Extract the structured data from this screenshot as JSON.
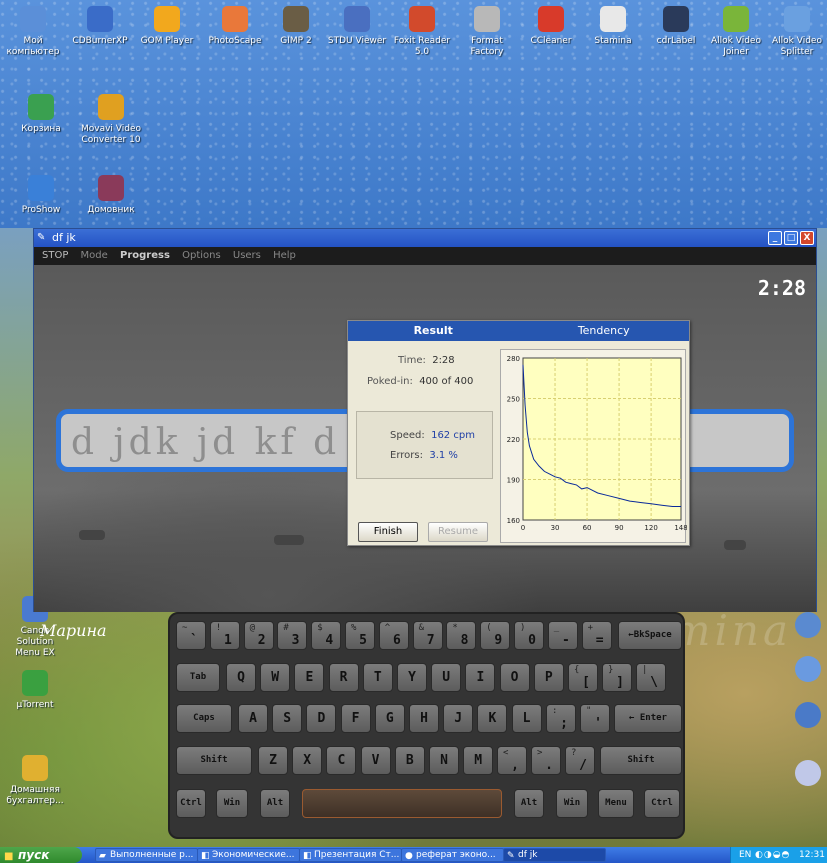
{
  "desktop_icons_top": [
    {
      "label": "Мой компьютер",
      "icon": "my-computer-icon",
      "color": "#5b8fd8"
    },
    {
      "label": "CDBurnerXP",
      "icon": "cdburnerxp-icon",
      "color": "#3a6cc8"
    },
    {
      "label": "GOM Player",
      "icon": "gom-player-icon",
      "color": "#f2a81d"
    },
    {
      "label": "PhotoScape",
      "icon": "photoscape-icon",
      "color": "#e9783a"
    },
    {
      "label": "GIMP 2",
      "icon": "gimp-icon",
      "color": "#6a5d45"
    },
    {
      "label": "STDU Viewer",
      "icon": "stdu-viewer-icon",
      "color": "#4a6fc0"
    },
    {
      "label": "Foxit Reader 5.0",
      "icon": "foxit-reader-icon",
      "color": "#d24a2c"
    },
    {
      "label": "Format Factory",
      "icon": "format-factory-icon",
      "color": "#b8b8b8"
    },
    {
      "label": "CCleaner",
      "icon": "ccleaner-icon",
      "color": "#d83a2a"
    },
    {
      "label": "Stamina",
      "icon": "stamina-icon",
      "color": "#e8e8e8"
    },
    {
      "label": "cdrLabel",
      "icon": "cdrlabel-icon",
      "color": "#2a3a5a"
    },
    {
      "label": "Allok Video Joiner",
      "icon": "allok-video-joiner-icon",
      "color": "#7ab53a"
    },
    {
      "label": "Allok Video Splitter",
      "icon": "allok-video-splitter-icon",
      "color": "#6aa0e0"
    }
  ],
  "desktop_icons_second": [
    {
      "label": "Корзина",
      "icon": "recycle-bin-icon",
      "color": "#3aa050"
    },
    {
      "label": "Movavi Video Converter 10",
      "icon": "movavi-icon",
      "color": "#e0a020"
    }
  ],
  "desktop_icons_third": [
    {
      "label": "ProShow",
      "icon": "proshow-icon",
      "color": "#3a80d8"
    },
    {
      "label": "Домовник",
      "icon": "domovnik-icon",
      "color": "#8a3a5a"
    }
  ],
  "desktop_icons_left_lower": [
    {
      "label": "Canon Solution Menu EX",
      "icon": "canon-solution-icon",
      "color": "#4a7ad0"
    },
    {
      "label": "µTorrent",
      "icon": "utorrent-icon",
      "color": "#3aa040"
    },
    {
      "label": "Домашняя бухгалтер...",
      "icon": "home-accounting-icon",
      "color": "#e0b030"
    }
  ],
  "window": {
    "title": "df jk",
    "menu": [
      "STOP",
      "Mode",
      "Progress",
      "Options",
      "Users",
      "Help"
    ],
    "timer": "2:28",
    "typed_text": "d jdk jd kf d",
    "username": "Марина",
    "watermark": "stamina"
  },
  "dialog": {
    "tabs": [
      "Result",
      "Tendency"
    ],
    "time_label": "Time:",
    "time_value": "2:28",
    "poked_label": "Poked-in:",
    "poked_value": "400 of 400",
    "speed_label": "Speed:",
    "speed_value": "162 cpm",
    "errors_label": "Errors:",
    "errors_value": "3.1 %",
    "finish_label": "Finish",
    "resume_label": "Resume"
  },
  "chart_data": {
    "type": "line",
    "title": "",
    "xlabel": "",
    "ylabel": "",
    "xlim": [
      0,
      148
    ],
    "ylim": [
      160,
      280
    ],
    "x_ticks": [
      "0",
      "30",
      "60",
      "90",
      "120",
      "148"
    ],
    "y_ticks": [
      "280",
      "250",
      "220",
      "190",
      "160"
    ],
    "grid": true,
    "background": "#ffffc0",
    "line_color": "#0a2a9a",
    "x": [
      0,
      2,
      4,
      6,
      10,
      15,
      20,
      25,
      30,
      35,
      40,
      45,
      50,
      55,
      60,
      65,
      70,
      80,
      90,
      100,
      110,
      120,
      130,
      140,
      148
    ],
    "y": [
      275,
      245,
      225,
      215,
      205,
      200,
      196,
      194,
      192,
      191,
      188,
      187,
      186,
      183,
      184,
      182,
      180,
      178,
      176,
      174,
      173,
      172,
      171,
      170,
      170
    ]
  },
  "keyboard": {
    "row1": [
      {
        "s": "~",
        "m": "`"
      },
      {
        "s": "!",
        "m": "1"
      },
      {
        "s": "@",
        "m": "2"
      },
      {
        "s": "#",
        "m": "3"
      },
      {
        "s": "$",
        "m": "4"
      },
      {
        "s": "%",
        "m": "5"
      },
      {
        "s": "^",
        "m": "6"
      },
      {
        "s": "&",
        "m": "7"
      },
      {
        "s": "*",
        "m": "8"
      },
      {
        "s": "(",
        "m": "9"
      },
      {
        "s": ")",
        "m": "0"
      },
      {
        "s": "_",
        "m": "-"
      },
      {
        "s": "+",
        "m": "="
      }
    ],
    "backspace": "←BkSpace",
    "tab": "Tab",
    "row2": [
      "Q",
      "W",
      "E",
      "R",
      "T",
      "Y",
      "U",
      "I",
      "O",
      "P"
    ],
    "row2_extra": [
      {
        "s": "{",
        "m": "["
      },
      {
        "s": "}",
        "m": "]"
      },
      {
        "s": "|",
        "m": "\\"
      }
    ],
    "caps": "Caps",
    "row3": [
      "A",
      "S",
      "D",
      "F",
      "G",
      "H",
      "J",
      "K",
      "L"
    ],
    "row3_extra": [
      {
        "s": ":",
        "m": ";"
      },
      {
        "s": "\"",
        "m": "'"
      }
    ],
    "enter": "← Enter",
    "shift": "Shift",
    "row4": [
      "Z",
      "X",
      "C",
      "V",
      "B",
      "N",
      "M"
    ],
    "row4_extra": [
      {
        "s": "<",
        "m": ","
      },
      {
        "s": ">",
        "m": "."
      },
      {
        "s": "?",
        "m": "/"
      }
    ],
    "ctrl": "Ctrl",
    "win": "Win",
    "alt": "Alt",
    "menu": "Menu"
  },
  "taskbar": {
    "start": "пуск",
    "tasks": [
      {
        "label": "Выполненные р...",
        "icon": "folder-icon"
      },
      {
        "label": "Экономические...",
        "icon": "powerpoint-icon"
      },
      {
        "label": "Презентация Ст...",
        "icon": "powerpoint-icon"
      },
      {
        "label": "реферат эконо...",
        "icon": "opera-icon"
      },
      {
        "label": "df jk",
        "icon": "stamina-icon"
      }
    ],
    "lang": "EN",
    "clock": "12:31"
  }
}
